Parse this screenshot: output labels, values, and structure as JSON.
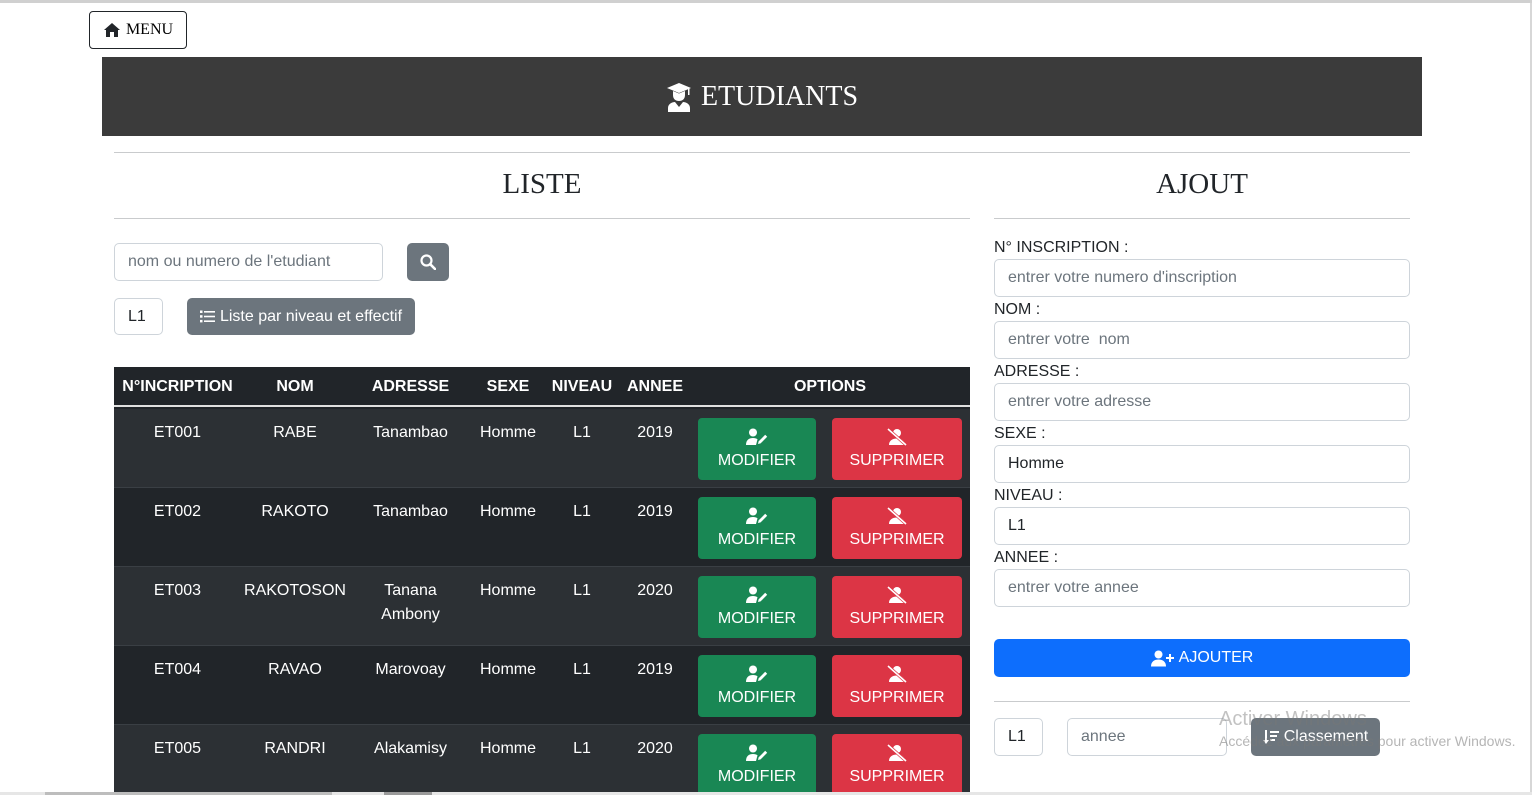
{
  "menu": {
    "label": "MENU",
    "icon": "home-icon"
  },
  "header": {
    "title": "ETUDIANTS",
    "icon": "user-graduate-icon",
    "background": "#3b3b3b"
  },
  "liste": {
    "title": "LISTE",
    "search_placeholder": "nom ou numero de l'etudiant",
    "niveau_value": "L1",
    "list_button": "Liste par niveau et effectif",
    "columns": [
      "N°INCRIPTION",
      "NOM",
      "ADRESSE",
      "SEXE",
      "NIVEAU",
      "ANNEE",
      "OPTIONS"
    ],
    "rows": [
      {
        "num": "ET001",
        "nom": "RABE",
        "adresse": "Tanambao",
        "sexe": "Homme",
        "niveau": "L1",
        "annee": "2019"
      },
      {
        "num": "ET002",
        "nom": "RAKOTO",
        "adresse": "Tanambao",
        "sexe": "Homme",
        "niveau": "L1",
        "annee": "2019"
      },
      {
        "num": "ET003",
        "nom": "RAKOTOSON",
        "adresse": "Tanana Ambony",
        "sexe": "Homme",
        "niveau": "L1",
        "annee": "2020"
      },
      {
        "num": "ET004",
        "nom": "RAVAO",
        "adresse": "Marovoay",
        "sexe": "Homme",
        "niveau": "L1",
        "annee": "2019"
      },
      {
        "num": "ET005",
        "nom": "RANDRI",
        "adresse": "Alakamisy",
        "sexe": "Homme",
        "niveau": "L1",
        "annee": "2020"
      }
    ],
    "modify_label": "MODIFIER",
    "delete_label": "SUPPRIMER",
    "colors": {
      "modify": "#198754",
      "delete": "#dc3545"
    }
  },
  "ajout": {
    "title": "AJOUT",
    "fields": [
      {
        "label": "N° INSCRIPTION :",
        "placeholder": "entrer votre numero d'inscription",
        "value": ""
      },
      {
        "label": "NOM :",
        "placeholder": "entrer votre  nom",
        "value": ""
      },
      {
        "label": "ADRESSE :",
        "placeholder": "entrer votre adresse",
        "value": ""
      },
      {
        "label": "SEXE :",
        "placeholder": "",
        "value": "Homme"
      },
      {
        "label": "NIVEAU :",
        "placeholder": "",
        "value": "L1"
      },
      {
        "label": "ANNEE :",
        "placeholder": "entrer votre annee",
        "value": ""
      }
    ],
    "submit_label": "AJOUTER",
    "submit_color": "#0d6efd"
  },
  "classement": {
    "niveau_value": "L1",
    "annee_placeholder": "annee",
    "button_label": "Classement"
  },
  "watermark": {
    "line1": "Activer Windows",
    "line2": "Accédez aux paramètres pour activer Windows."
  }
}
